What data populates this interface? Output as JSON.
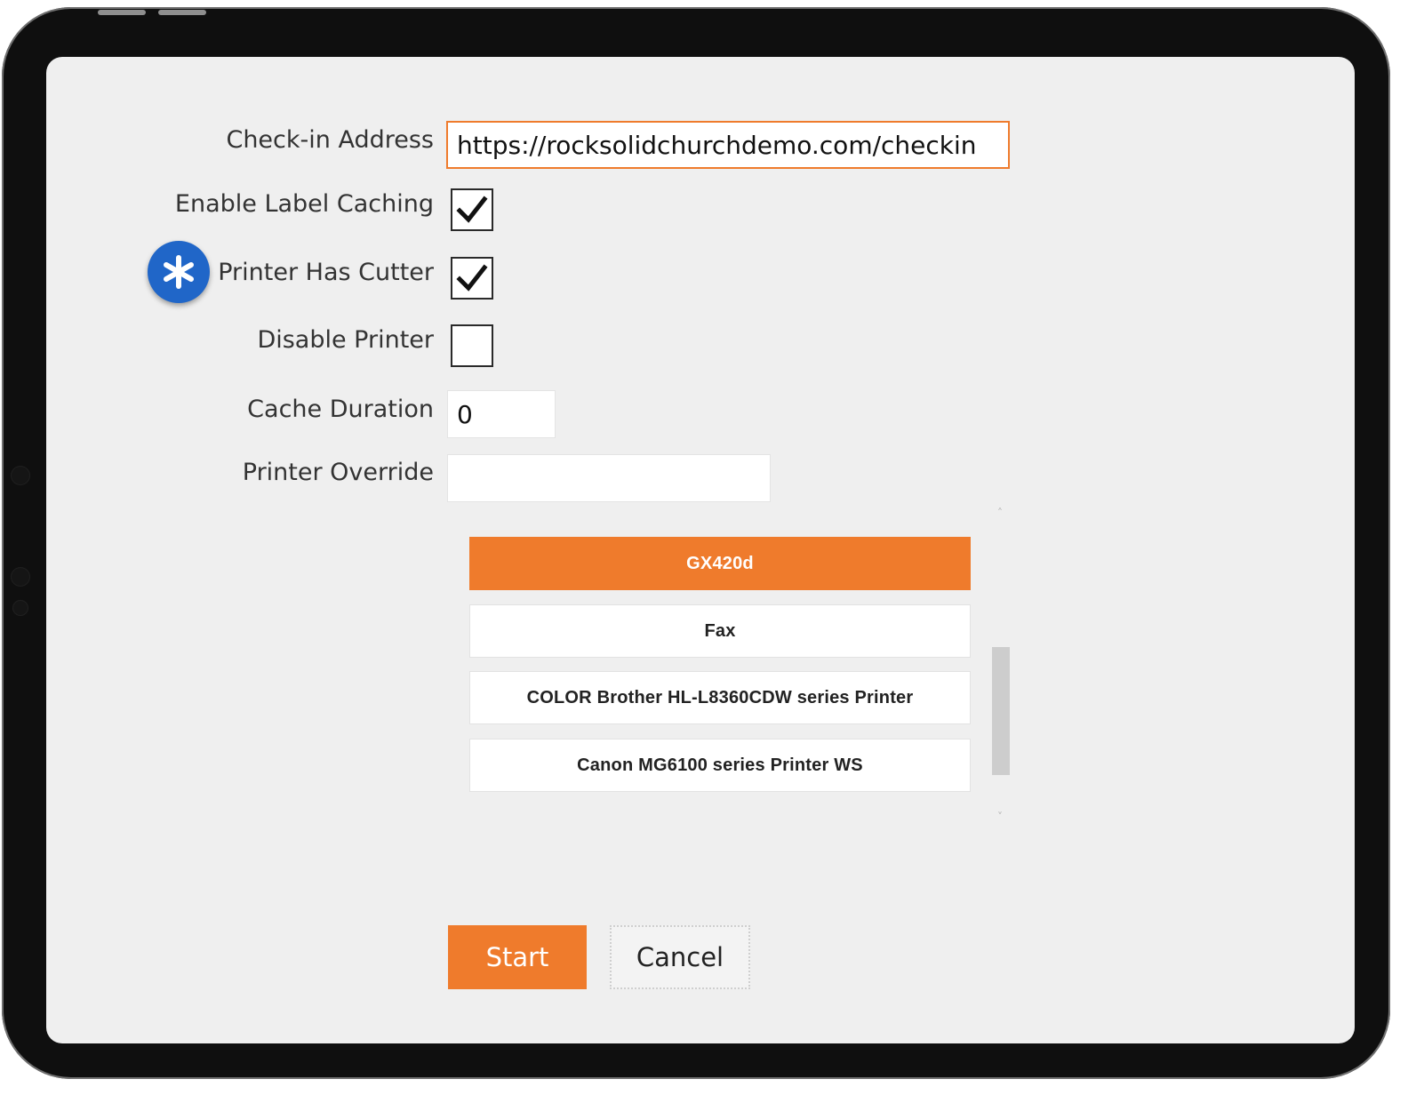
{
  "form": {
    "checkin_address": {
      "label": "Check-in Address",
      "value": "https://rocksolidchurchdemo.com/checkin"
    },
    "enable_label_caching": {
      "label": "Enable Label Caching",
      "checked": true
    },
    "printer_has_cutter": {
      "label": "Printer Has Cutter",
      "checked": true
    },
    "disable_printer": {
      "label": "Disable Printer",
      "checked": false
    },
    "cache_duration": {
      "label": "Cache Duration",
      "value": "0"
    },
    "printer_override": {
      "label": "Printer Override",
      "value": ""
    }
  },
  "printers": {
    "items": [
      {
        "label": "GX420d",
        "selected": true
      },
      {
        "label": "Fax",
        "selected": false
      },
      {
        "label": "COLOR Brother HL-L8360CDW series Printer",
        "selected": false
      },
      {
        "label": "Canon MG6100 series Printer WS",
        "selected": false
      }
    ]
  },
  "actions": {
    "start_label": "Start",
    "cancel_label": "Cancel"
  },
  "icons": {
    "badge": "asterisk-icon",
    "check": "checkmark-icon",
    "scroll_up": "chevron-up-icon",
    "scroll_down": "chevron-down-icon"
  },
  "colors": {
    "accent": "#ef7b2c",
    "badge": "#2066c8",
    "screen_bg": "#efefef",
    "device_frame": "#0f0f0f"
  }
}
